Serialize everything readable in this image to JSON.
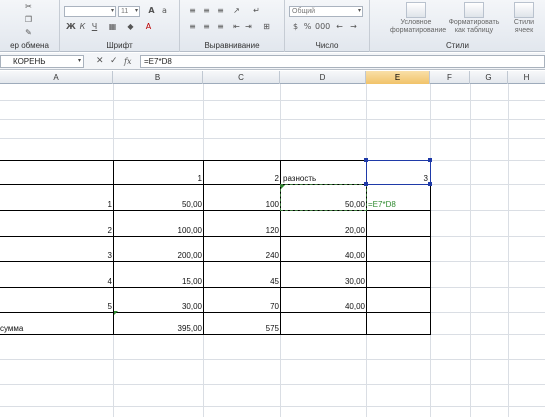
{
  "ribbon": {
    "clipboard_label": "ер обмена",
    "font_label": "Шрифт",
    "font_size": "11",
    "bold": "Ж",
    "italic": "К",
    "underline": "Ч",
    "alignment_label": "Выравнивание",
    "number_label": "Число",
    "number_format": "Общий",
    "styles_label": "Стили",
    "conditional_formatting": "Условное форматирование",
    "format_as_table": "Форматировать как таблицу",
    "cell_styles": "Стили ячеек"
  },
  "formula_bar": {
    "name_box": "КОРЕНЬ",
    "cancel": "✕",
    "enter": "✓",
    "fx": "fx",
    "formula": "=E7*D8"
  },
  "columns": [
    "A",
    "B",
    "C",
    "D",
    "E",
    "F",
    "G",
    "H"
  ],
  "selected_column": "E",
  "cells": {
    "row_header": {
      "b": "1",
      "c": "2",
      "d": "разность",
      "e": "3"
    },
    "rows": [
      {
        "a": "1",
        "b": "50,00",
        "c": "100",
        "d": "50,00",
        "e": "=E7*D8"
      },
      {
        "a": "2",
        "b": "100,00",
        "c": "120",
        "d": "20,00"
      },
      {
        "a": "3",
        "b": "200,00",
        "c": "240",
        "d": "40,00"
      },
      {
        "a": "4",
        "b": "15,00",
        "c": "45",
        "d": "30,00"
      },
      {
        "a": "5",
        "b": "30,00",
        "c": "70",
        "d": "40,00"
      }
    ],
    "total": {
      "a": "сумма",
      "b": "395,00",
      "c": "575"
    }
  },
  "colors": {
    "selection_border": "#1f3aa8",
    "marching_ants": "#3c7a3c",
    "formula_ref_green": "#2f8a2f",
    "selected_header": "#f1c36a"
  }
}
